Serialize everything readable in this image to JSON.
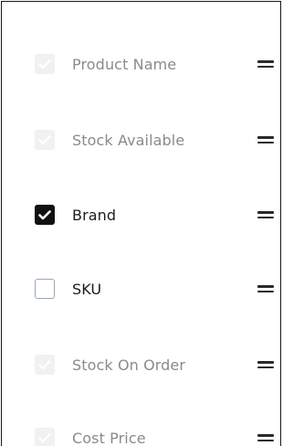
{
  "columns": [
    {
      "label": "Product Name",
      "state": "disabled"
    },
    {
      "label": "Stock Available",
      "state": "disabled"
    },
    {
      "label": "Brand",
      "state": "checked"
    },
    {
      "label": "SKU",
      "state": "unchecked"
    },
    {
      "label": "Stock On Order",
      "state": "disabled"
    },
    {
      "label": "Cost Price",
      "state": "disabled"
    }
  ],
  "icons": {
    "checkmark": "check-icon",
    "drag": "drag-handle-icon"
  },
  "colors": {
    "border": "#1a1a1a",
    "checked_fill": "#111111",
    "disabled_fill": "#f0f1f3",
    "unchecked_border": "#9aa7b8",
    "muted_text": "#8a8a8a",
    "active_text": "#1c1c1c"
  }
}
